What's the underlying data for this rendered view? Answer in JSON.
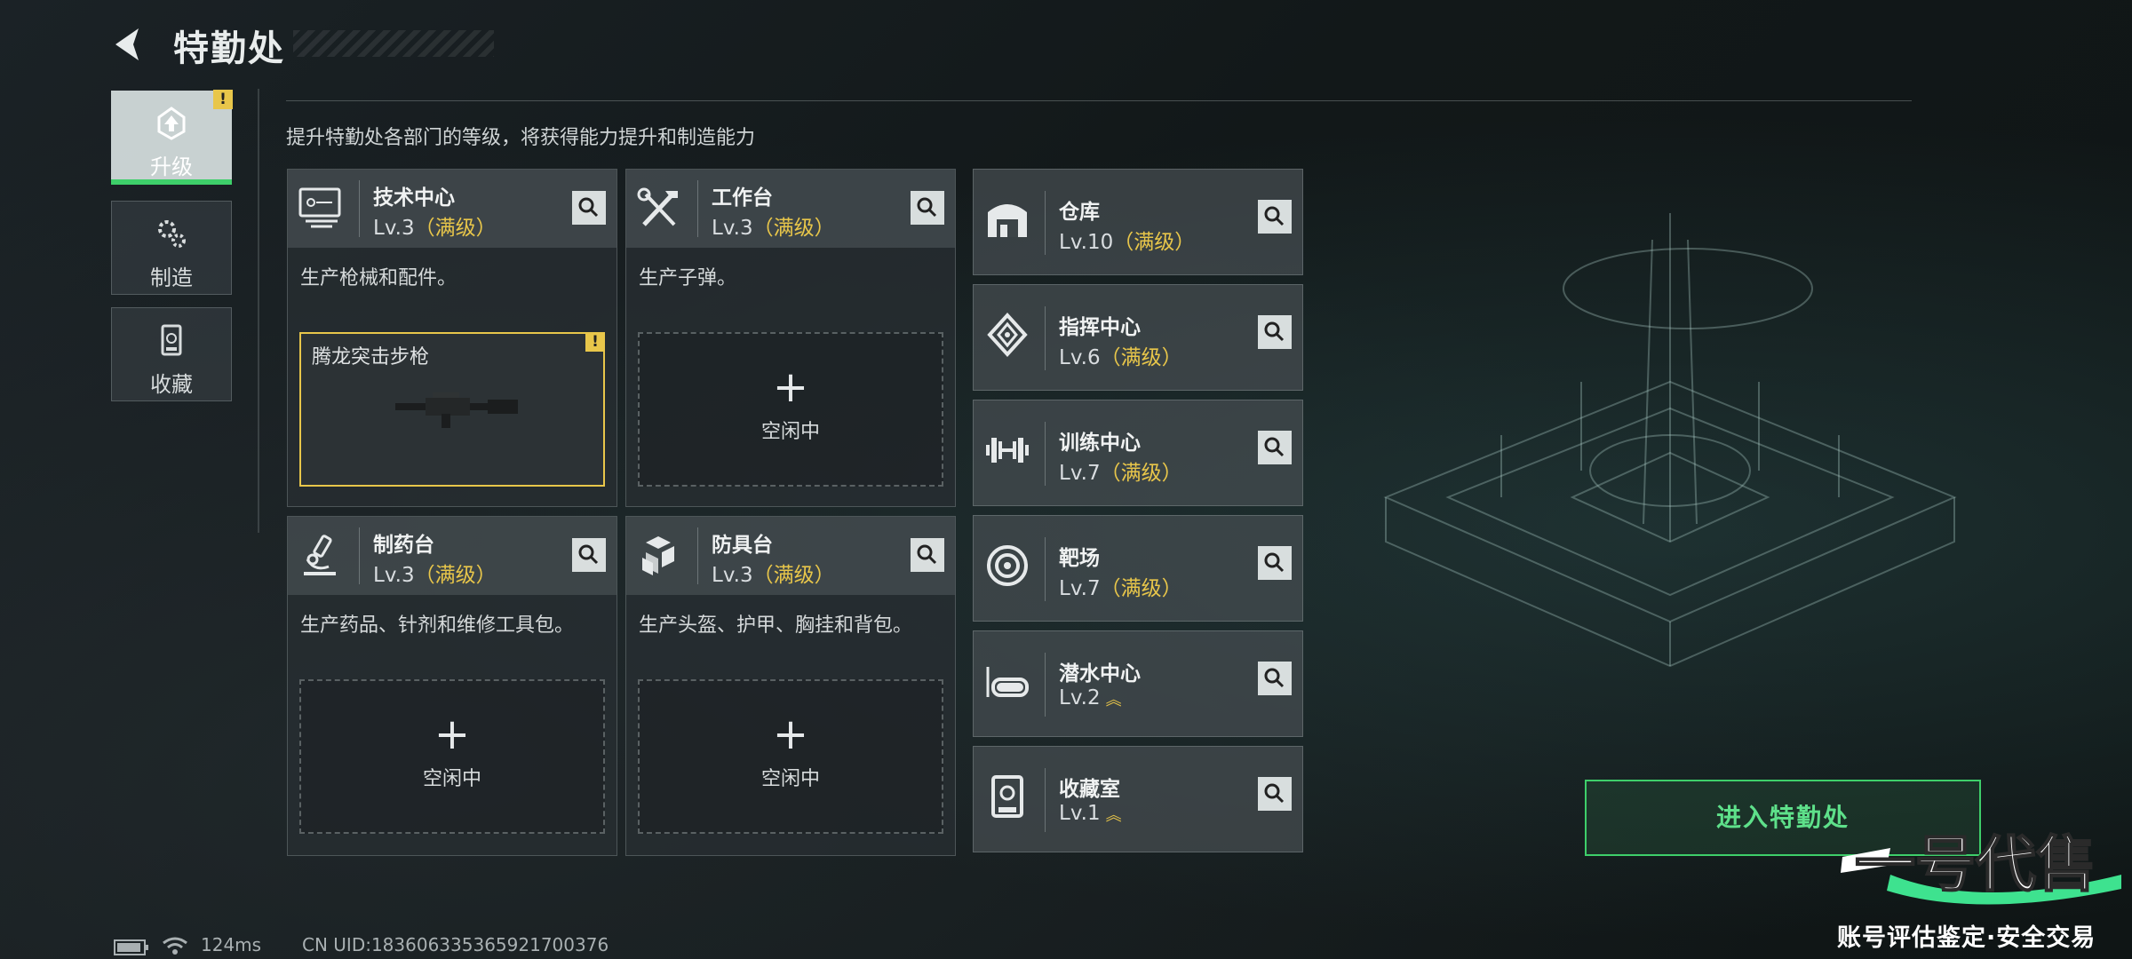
{
  "header": {
    "title": "特勤处"
  },
  "sidebar": {
    "items": [
      {
        "label": "升级",
        "icon": "upgrade-icon",
        "active": true,
        "warning": "!"
      },
      {
        "label": "制造",
        "icon": "gears-icon",
        "active": false
      },
      {
        "label": "收藏",
        "icon": "collection-icon",
        "active": false
      }
    ]
  },
  "subtitle": "提升特勤处各部门的等级，将获得能力提升和制造能力",
  "modules": [
    {
      "name": "技术中心",
      "level": "Lv.3",
      "status": "（满级）",
      "desc": "生产枪械和配件。",
      "slot": {
        "filled": true,
        "item": "腾龙突击步枪",
        "warning": "!"
      },
      "icon": "computer-icon"
    },
    {
      "name": "工作台",
      "level": "Lv.3",
      "status": "（满级）",
      "desc": "生产子弹。",
      "slot": {
        "filled": false,
        "plus": "+",
        "idle": "空闲中"
      },
      "icon": "tools-icon"
    },
    {
      "name": "制药台",
      "level": "Lv.3",
      "status": "（满级）",
      "desc": "生产药品、针剂和维修工具包。",
      "slot": {
        "filled": false,
        "plus": "+",
        "idle": "空闲中"
      },
      "icon": "microscope-icon"
    },
    {
      "name": "防具台",
      "level": "Lv.3",
      "status": "（满级）",
      "desc": "生产头盔、护甲、胸挂和背包。",
      "slot": {
        "filled": false,
        "plus": "+",
        "idle": "空闲中"
      },
      "icon": "armor-icon"
    }
  ],
  "facilities": [
    {
      "name": "仓库",
      "level": "Lv.10",
      "status": "（满级）",
      "icon": "warehouse-icon"
    },
    {
      "name": "指挥中心",
      "level": "Lv.6",
      "status": "（满级）",
      "icon": "chip-icon"
    },
    {
      "name": "训练中心",
      "level": "Lv.7",
      "status": "（满级）",
      "icon": "dumbbell-icon"
    },
    {
      "name": "靶场",
      "level": "Lv.7",
      "status": "（满级）",
      "icon": "target-icon"
    },
    {
      "name": "潜水中心",
      "level": "Lv.2",
      "status": "",
      "upgradable": true,
      "icon": "dive-mask-icon"
    },
    {
      "name": "收藏室",
      "level": "Lv.1",
      "status": "",
      "upgradable": true,
      "icon": "trophy-case-icon"
    }
  ],
  "enter_button": "进入特勤处",
  "footer": {
    "ping": "124ms",
    "uid": "CN UID:183606335365921700376"
  },
  "watermark": {
    "logo_text": "一号代售",
    "text": "账号评估鉴定·安全交易"
  },
  "colors": {
    "accent_green": "#3ecf6a",
    "maxed_yellow": "#e8c64a"
  }
}
